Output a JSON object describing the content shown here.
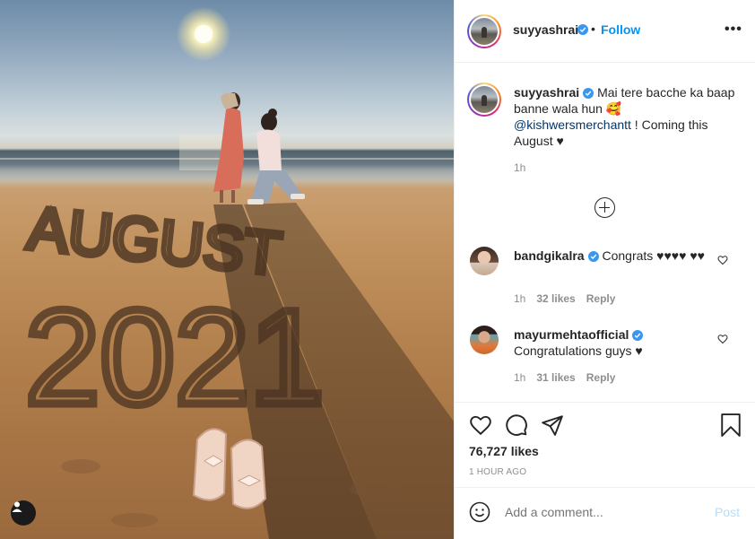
{
  "post": {
    "author": "suyyashrai",
    "follow_label": "Follow",
    "separator": "•",
    "more_label": "•••",
    "caption_main": "Mai tere bacche ka baap banne wala hun 🥰",
    "caption_mention": "@kishwersmerchantt",
    "caption_end": " ! Coming this August ♥",
    "caption_time": "1h",
    "likes_text": "76,727 likes",
    "posted_ago": "1 HOUR AGO"
  },
  "photo": {
    "sand_text_month": "AUGUST",
    "sand_text_year": "2021"
  },
  "comments": [
    {
      "user": "bandgikalra",
      "text": "Congrats ♥♥♥♥ ♥♥",
      "time": "1h",
      "likes": "32 likes",
      "reply": "Reply"
    },
    {
      "user": "mayurmehtaofficial",
      "text": "Congratulations guys ♥",
      "time": "1h",
      "likes": "31 likes",
      "reply": "Reply"
    }
  ],
  "add_comment": {
    "placeholder": "Add a comment...",
    "post_label": "Post"
  },
  "colors": {
    "accent": "#0095f6",
    "verified": "#3897f0",
    "muted": "#8e8e8e"
  },
  "icons": [
    "heart-icon",
    "comment-icon",
    "share-icon",
    "bookmark-icon",
    "emoji-icon",
    "plus-circle-icon",
    "verified-icon",
    "user-tag-icon"
  ]
}
